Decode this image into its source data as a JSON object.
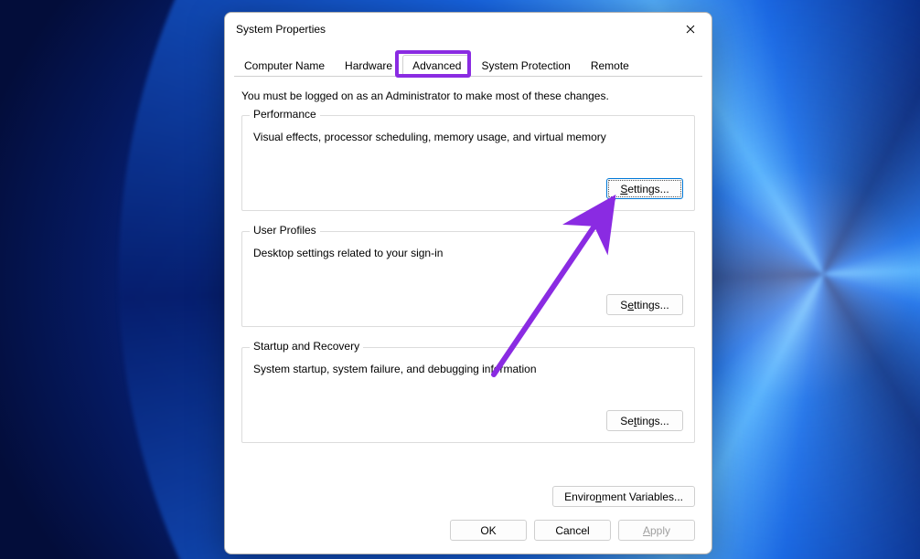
{
  "window": {
    "title": "System Properties"
  },
  "tabs": {
    "computer_name": "Computer Name",
    "hardware": "Hardware",
    "advanced": "Advanced",
    "system_protection": "System Protection",
    "remote": "Remote"
  },
  "intro": "You must be logged on as an Administrator to make most of these changes.",
  "groups": {
    "performance": {
      "title": "Performance",
      "desc": "Visual effects, processor scheduling, memory usage, and virtual memory",
      "button": "Settings..."
    },
    "user_profiles": {
      "title": "User Profiles",
      "desc": "Desktop settings related to your sign-in",
      "button": "Settings..."
    },
    "startup_recovery": {
      "title": "Startup and Recovery",
      "desc": "System startup, system failure, and debugging information",
      "button": "Settings..."
    }
  },
  "env_button": "Environment Variables...",
  "footer": {
    "ok": "OK",
    "cancel": "Cancel",
    "apply": "Apply"
  },
  "annotations": {
    "highlight_tab": "advanced",
    "arrow_color": "#8a2be2"
  }
}
